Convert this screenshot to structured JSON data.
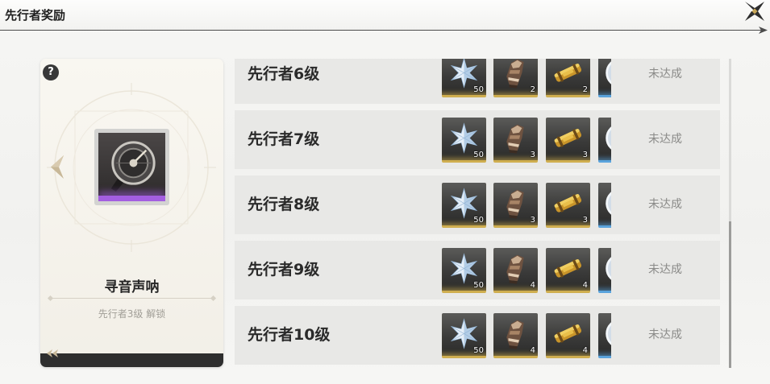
{
  "header": {
    "title": "先行者奖励"
  },
  "card": {
    "help": "?",
    "item_icon": "sonar-disc-icon",
    "title": "寻音声呐",
    "subtitle": "先行者3级 解锁"
  },
  "rows": [
    {
      "label": "先行者6级",
      "items": [
        {
          "icon": "star-crystal-icon",
          "count": "50"
        },
        {
          "icon": "gauntlet-icon",
          "count": "2"
        },
        {
          "icon": "scroll-icon",
          "count": "2"
        },
        {
          "icon": "disc-icon"
        }
      ],
      "status": "未达成"
    },
    {
      "label": "先行者7级",
      "items": [
        {
          "icon": "star-crystal-icon",
          "count": "50"
        },
        {
          "icon": "gauntlet-icon",
          "count": "3"
        },
        {
          "icon": "scroll-icon",
          "count": "3"
        },
        {
          "icon": "disc-icon"
        }
      ],
      "status": "未达成"
    },
    {
      "label": "先行者8级",
      "items": [
        {
          "icon": "star-crystal-icon",
          "count": "50"
        },
        {
          "icon": "gauntlet-icon",
          "count": "3"
        },
        {
          "icon": "scroll-icon",
          "count": "3"
        },
        {
          "icon": "disc-icon"
        }
      ],
      "status": "未达成"
    },
    {
      "label": "先行者9级",
      "items": [
        {
          "icon": "star-crystal-icon",
          "count": "50"
        },
        {
          "icon": "gauntlet-icon",
          "count": "4"
        },
        {
          "icon": "scroll-icon",
          "count": "4"
        },
        {
          "icon": "disc-icon"
        }
      ],
      "status": "未达成"
    },
    {
      "label": "先行者10级",
      "items": [
        {
          "icon": "star-crystal-icon",
          "count": "50"
        },
        {
          "icon": "gauntlet-icon",
          "count": "4"
        },
        {
          "icon": "scroll-icon",
          "count": "4"
        },
        {
          "icon": "disc-icon"
        }
      ],
      "status": "未达成"
    }
  ],
  "colors": {
    "item_bar_gold": "#cfae4f",
    "item_bar_blue": "#5aa3dc",
    "rarity_purple": "#a35ee0",
    "row_background": "#e8e8e6"
  }
}
